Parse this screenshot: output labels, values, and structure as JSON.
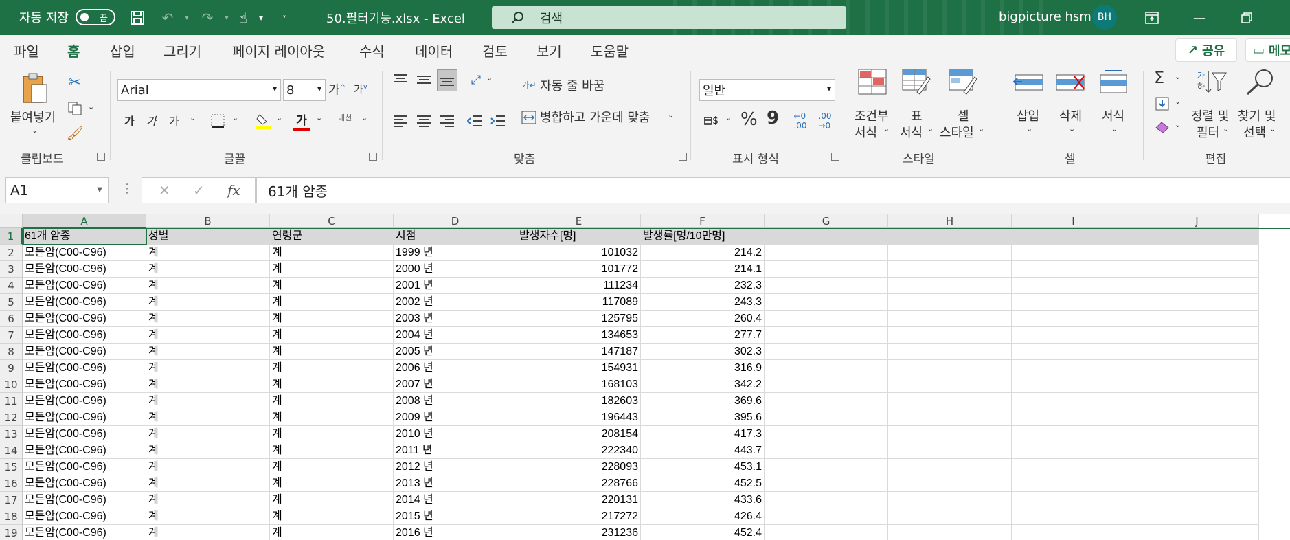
{
  "titlebar": {
    "autosave_label": "자동 저장",
    "autosave_state": "끔",
    "doc_title": "50.필터기능.xlsx  -  Excel",
    "search_placeholder": "검색",
    "user_name": "bigpicture hsm",
    "user_initials": "BH"
  },
  "menu": {
    "tabs": [
      "파일",
      "홈",
      "삽입",
      "그리기",
      "페이지 레이아웃",
      "수식",
      "데이터",
      "검토",
      "보기",
      "도움말"
    ],
    "active": "홈",
    "share": "공유",
    "memo": "메모"
  },
  "ribbon": {
    "clipboard": {
      "paste": "붙여넣기",
      "label": "클립보드"
    },
    "font": {
      "name": "Arial",
      "size": "8",
      "bold": "가",
      "italic": "가",
      "underline": "가",
      "color": "가",
      "phonetic": "내천",
      "label": "글꼴"
    },
    "alignment": {
      "wrap": "자동 줄 바꿈",
      "merge": "병합하고 가운데 맞춤",
      "label": "맞춤"
    },
    "number": {
      "format": "일반",
      "percent": "%",
      "comma": "9",
      "label": "표시 형식"
    },
    "styles": {
      "conditional_1": "조건부",
      "conditional_2": "서식",
      "table_1": "표",
      "table_2": "서식",
      "cell_1": "셀",
      "cell_2": "스타일",
      "label": "스타일"
    },
    "cells": {
      "insert": "삽입",
      "delete": "삭제",
      "format": "서식",
      "label": "셀"
    },
    "editing": {
      "sort_1": "정렬 및",
      "sort_2": "필터",
      "find_1": "찾기 및",
      "find_2": "선택",
      "label": "편집"
    }
  },
  "formula_bar": {
    "name_box": "A1",
    "fx": "fx",
    "formula": "61개 암종"
  },
  "sheet": {
    "columns": [
      "A",
      "B",
      "C",
      "D",
      "E",
      "F",
      "G",
      "H",
      "I",
      "J"
    ],
    "selected_cell": "A1",
    "header_row": [
      "61개 암종",
      "성별",
      "연령군",
      "시점",
      "발생자수[명]",
      "발생률[명/10만명]"
    ],
    "rows": [
      [
        "모든암(C00-C96)",
        "계",
        "계",
        "1999 년",
        "101032",
        "214.2"
      ],
      [
        "모든암(C00-C96)",
        "계",
        "계",
        "2000 년",
        "101772",
        "214.1"
      ],
      [
        "모든암(C00-C96)",
        "계",
        "계",
        "2001 년",
        "111234",
        "232.3"
      ],
      [
        "모든암(C00-C96)",
        "계",
        "계",
        "2002 년",
        "117089",
        "243.3"
      ],
      [
        "모든암(C00-C96)",
        "계",
        "계",
        "2003 년",
        "125795",
        "260.4"
      ],
      [
        "모든암(C00-C96)",
        "계",
        "계",
        "2004 년",
        "134653",
        "277.7"
      ],
      [
        "모든암(C00-C96)",
        "계",
        "계",
        "2005 년",
        "147187",
        "302.3"
      ],
      [
        "모든암(C00-C96)",
        "계",
        "계",
        "2006 년",
        "154931",
        "316.9"
      ],
      [
        "모든암(C00-C96)",
        "계",
        "계",
        "2007 년",
        "168103",
        "342.2"
      ],
      [
        "모든암(C00-C96)",
        "계",
        "계",
        "2008 년",
        "182603",
        "369.6"
      ],
      [
        "모든암(C00-C96)",
        "계",
        "계",
        "2009 년",
        "196443",
        "395.6"
      ],
      [
        "모든암(C00-C96)",
        "계",
        "계",
        "2010 년",
        "208154",
        "417.3"
      ],
      [
        "모든암(C00-C96)",
        "계",
        "계",
        "2011 년",
        "222340",
        "443.7"
      ],
      [
        "모든암(C00-C96)",
        "계",
        "계",
        "2012 년",
        "228093",
        "453.1"
      ],
      [
        "모든암(C00-C96)",
        "계",
        "계",
        "2013 년",
        "228766",
        "452.5"
      ],
      [
        "모든암(C00-C96)",
        "계",
        "계",
        "2014 년",
        "220131",
        "433.6"
      ],
      [
        "모든암(C00-C96)",
        "계",
        "계",
        "2015 년",
        "217272",
        "426.4"
      ],
      [
        "모든암(C00-C96)",
        "계",
        "계",
        "2016 년",
        "231236",
        "452.4"
      ]
    ]
  },
  "colors": {
    "accent": "#1e7145",
    "search_bg": "#c9e3d2",
    "avatar": "#0d7a78"
  }
}
